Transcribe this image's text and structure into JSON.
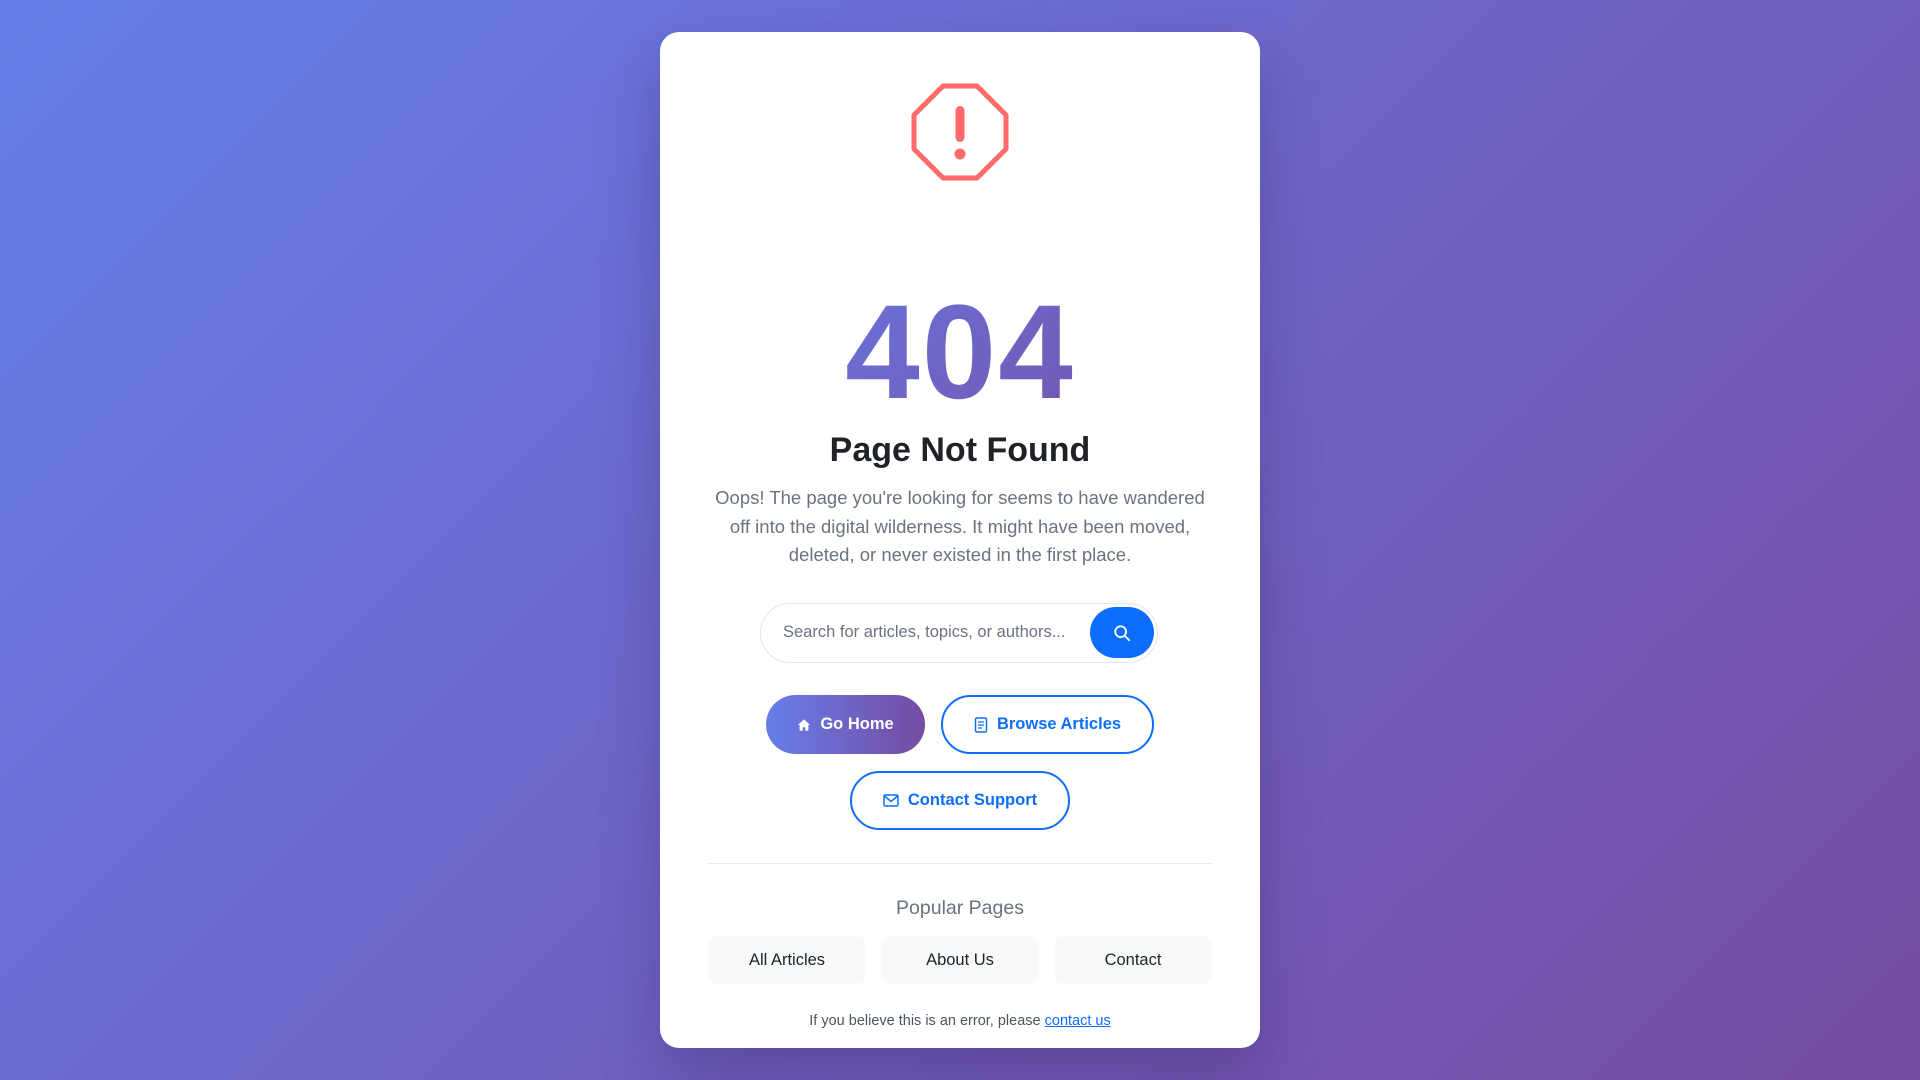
{
  "error": {
    "icon": "octagon-exclamation-icon",
    "code": "404",
    "title": "Page Not Found",
    "description": "Oops! The page you're looking for seems to have wandered off into the digital wilderness. It might have been moved, deleted, or never existed in the first place."
  },
  "search": {
    "placeholder": "Search for articles, topics, or authors...",
    "value": "",
    "button_icon": "search-icon"
  },
  "actions": {
    "home_label": "Go Home",
    "home_icon": "home-icon",
    "browse_label": "Browse Articles",
    "browse_icon": "document-icon",
    "contact_label": "Contact Support",
    "contact_icon": "envelope-icon"
  },
  "popular": {
    "title": "Popular Pages",
    "links": [
      {
        "label": "All Articles"
      },
      {
        "label": "About Us"
      },
      {
        "label": "Contact"
      }
    ]
  },
  "footer": {
    "text": "If you believe this is an error, please ",
    "link_label": "contact us"
  },
  "colors": {
    "gradient_start": "#667eea",
    "gradient_end": "#764ba2",
    "primary": "#0d6efd",
    "warning": "#ff6b6b"
  }
}
